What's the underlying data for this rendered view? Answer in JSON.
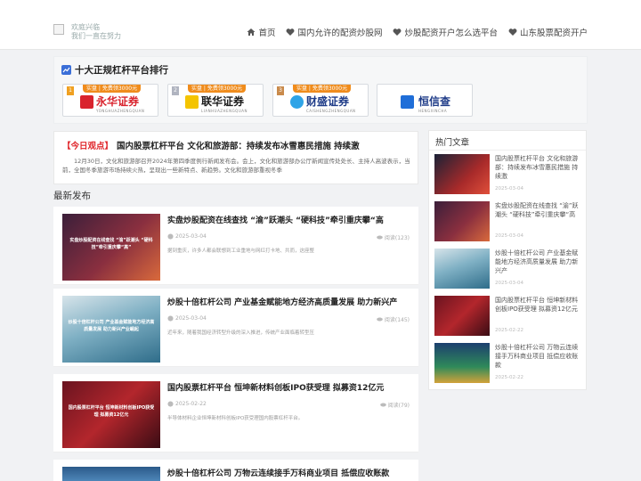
{
  "header": {
    "logo_line1": "欢庭兴临",
    "logo_line2": "我们一直在努力",
    "nav": [
      {
        "label": "首页",
        "icon": "home-icon"
      },
      {
        "label": "国内允许的配资炒股网",
        "icon": "heart-icon"
      },
      {
        "label": "炒股配资开户怎么选平台",
        "icon": "heart-icon"
      },
      {
        "label": "山东股票配资开户",
        "icon": "heart-icon"
      }
    ]
  },
  "ranking": {
    "title": "十大正规杠杆平台排行",
    "brands": [
      {
        "rank": "1",
        "ribbon": "实盘 | 免费领3000元",
        "name": "永华证券",
        "sub": "YONGHUAZHENGQUAN",
        "color": "#d9232d"
      },
      {
        "rank": "2",
        "ribbon": "实盘 | 免费领3000元",
        "name": "联华证券",
        "sub": "LIANHUAZHENGQUAN",
        "color": "#1b1b1b"
      },
      {
        "rank": "3",
        "ribbon": "实盘 | 免费领3000元",
        "name": "财盛证券",
        "sub": "CAISHENGZHENGQUAN",
        "color": "#1f3c88"
      },
      {
        "rank": "",
        "ribbon": "",
        "name": "恒信查",
        "sub": "HENGXINCHA",
        "color": "#1f3c88"
      }
    ]
  },
  "today": {
    "tag": "【今日观点】",
    "title": "国内股票杠杆平台 文化和旅游部：持续发布冰雪惠民措施 持续激",
    "desc": "12月30日，文化和旅游部召开2024年第四季度例行新闻发布会。会上，文化和旅游部办公厅新闻宣传处处长、主持人高波表示，当前，全国冬季旅游市场持续火热，呈现出一些新特点、新趋势。文化和旅游部重视冬季"
  },
  "latest": {
    "title": "最新发布",
    "posts": [
      {
        "title": "实盘炒股配资在线查找 “渝”跃潮头 “硬科技”牵引重庆攀“高",
        "date": "2025-03-04",
        "views": "阅读(123)",
        "excerpt": "据到重庆，许多人都会联想到工业重地与网红打卡地、共而，这座整",
        "thumb_text": "实盘炒股配资在线查找 “渝”跃潮头 “硬科技”牵引重庆攀“高”"
      },
      {
        "title": "炒股十倍杠杆公司 产业基金赋能地方经济高质量发展 助力新兴产",
        "date": "2025-03-04",
        "views": "阅读(145)",
        "excerpt": "近年来，随着我国经济转型升级的深入推进，传统产业面临着转型压",
        "thumb_text": "炒股十倍杠杆公司 产业基金赋能地方经济高质量发展 助力新兴产业崛起"
      },
      {
        "title": "国内股票杠杆平台 恒坤新材料创板IPO获受理 拟募资12亿元",
        "date": "2025-02-22",
        "views": "阅读(79)",
        "excerpt": "半导体材料企业恒坤新材科创板IPO获受理国内股票杠杆平台。",
        "thumb_text": "国内股票杠杆平台 恒坤新材料创板IPO获受理 拟募资12亿元"
      },
      {
        "title": "炒股十倍杠杆公司 万物云连续接手万科商业项目 抵偿应收账款",
        "date": "",
        "views": "",
        "excerpt": "",
        "thumb_text": ""
      }
    ]
  },
  "sidebar": {
    "title": "热门文章",
    "items": [
      {
        "title": "国内股票杠杆平台 文化和旅游部：持续发布冰雪惠民措施 持续激",
        "date": "2025-03-04"
      },
      {
        "title": "实盘炒股配资在线查找 “渝”跃潮头 “硬科技”牵引重庆攀“高",
        "date": "2025-03-04"
      },
      {
        "title": "炒股十倍杠杆公司 产业基金赋能地方经济高质量发展 助力新兴产",
        "date": "2025-03-04"
      },
      {
        "title": "国内股票杠杆平台 恒坤新材料创板IPO获受理 拟募资12亿元",
        "date": "2025-02-22"
      },
      {
        "title": "炒股十倍杠杆公司 万物云连续接手万科商业项目 抵偿应收账款",
        "date": "2025-02-22"
      }
    ]
  }
}
